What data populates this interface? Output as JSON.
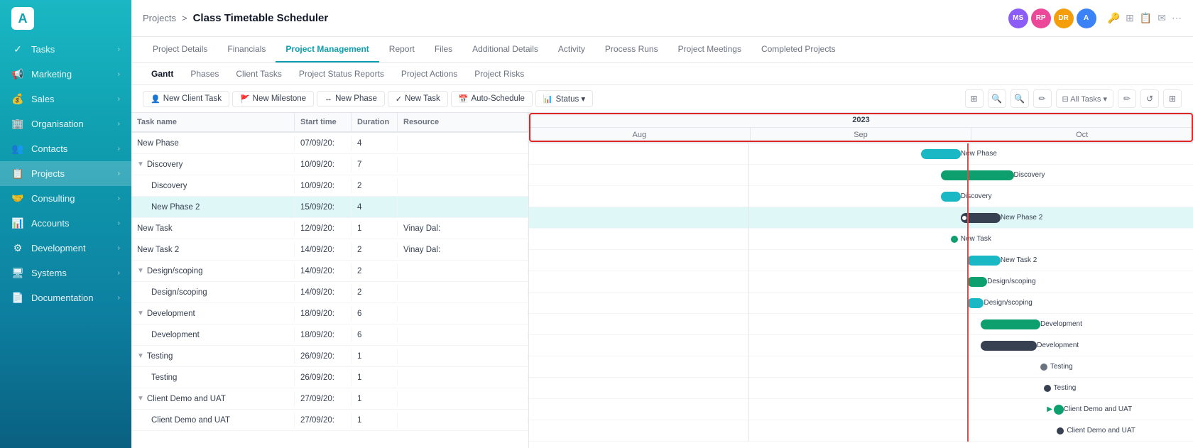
{
  "sidebar": {
    "logo": "A",
    "items": [
      {
        "label": "Tasks",
        "icon": "✓",
        "hasChevron": true
      },
      {
        "label": "Marketing",
        "icon": "📢",
        "hasChevron": true
      },
      {
        "label": "Sales",
        "icon": "💰",
        "hasChevron": true
      },
      {
        "label": "Organisation",
        "icon": "🏢",
        "hasChevron": true
      },
      {
        "label": "Contacts",
        "icon": "👥",
        "hasChevron": true
      },
      {
        "label": "Projects",
        "icon": "📋",
        "hasChevron": true,
        "active": true
      },
      {
        "label": "Consulting",
        "icon": "🤝",
        "hasChevron": true
      },
      {
        "label": "Accounts",
        "icon": "📊",
        "hasChevron": true
      },
      {
        "label": "Development",
        "icon": "⚙",
        "hasChevron": true
      },
      {
        "label": "Systems",
        "icon": "🖥",
        "hasChevron": true
      },
      {
        "label": "Documentation",
        "icon": "📄",
        "hasChevron": true
      }
    ]
  },
  "header": {
    "breadcrumb_parent": "Projects",
    "breadcrumb_sep": ">",
    "title": "Class Timetable Scheduler",
    "avatars": [
      {
        "initials": "MS",
        "color": "#8b5cf6"
      },
      {
        "initials": "RP",
        "color": "#ec4899"
      },
      {
        "initials": "DR",
        "color": "#f59e0b"
      },
      {
        "initials": "A",
        "color": "#3b82f6"
      }
    ]
  },
  "main_tabs": [
    {
      "label": "Project Details",
      "active": false
    },
    {
      "label": "Financials",
      "active": false
    },
    {
      "label": "Project Management",
      "active": true
    },
    {
      "label": "Report",
      "active": false
    },
    {
      "label": "Files",
      "active": false
    },
    {
      "label": "Additional Details",
      "active": false
    },
    {
      "label": "Activity",
      "active": false
    },
    {
      "label": "Process Runs",
      "active": false
    },
    {
      "label": "Project Meetings",
      "active": false
    },
    {
      "label": "Completed Projects",
      "active": false
    }
  ],
  "sub_tabs": [
    {
      "label": "Gantt",
      "active": true
    },
    {
      "label": "Phases",
      "active": false
    },
    {
      "label": "Client Tasks",
      "active": false
    },
    {
      "label": "Project Status Reports",
      "active": false
    },
    {
      "label": "Project Actions",
      "active": false
    },
    {
      "label": "Project Risks",
      "active": false
    }
  ],
  "toolbar": {
    "buttons": [
      {
        "label": "New Client Task",
        "icon": "👤"
      },
      {
        "label": "New Milestone",
        "icon": "🚩"
      },
      {
        "label": "New Phase",
        "icon": "↔"
      },
      {
        "label": "New Task",
        "icon": "✓"
      },
      {
        "label": "Auto-Schedule",
        "icon": "📅"
      },
      {
        "label": "Status ▾",
        "icon": "📊"
      }
    ],
    "right_icons": [
      "⊞",
      "🔍+",
      "🔍-",
      "✏",
      "⊟",
      "All Tasks ▾",
      "✏",
      "↺",
      "⊞"
    ]
  },
  "task_list": {
    "headers": [
      "Task name",
      "Start time",
      "Duration",
      "Resource"
    ],
    "rows": [
      {
        "indent": 0,
        "name": "New Phase",
        "start": "07/09/20:",
        "duration": "4",
        "resource": "",
        "bold": false,
        "collapse": false
      },
      {
        "indent": 0,
        "name": "Discovery",
        "start": "10/09/20:",
        "duration": "7",
        "resource": "",
        "bold": false,
        "collapse": true
      },
      {
        "indent": 1,
        "name": "Discovery",
        "start": "10/09/20:",
        "duration": "2",
        "resource": "",
        "bold": false,
        "collapse": false
      },
      {
        "indent": 1,
        "name": "New Phase 2",
        "start": "15/09/20:",
        "duration": "4",
        "resource": "",
        "bold": false,
        "collapse": false,
        "highlighted": true
      },
      {
        "indent": 0,
        "name": "New Task",
        "start": "12/09/20:",
        "duration": "1",
        "resource": "Vinay Dal:",
        "bold": false,
        "collapse": false
      },
      {
        "indent": 0,
        "name": "New Task 2",
        "start": "14/09/20:",
        "duration": "2",
        "resource": "Vinay Dal:",
        "bold": false,
        "collapse": false
      },
      {
        "indent": 0,
        "name": "Design/scoping",
        "start": "14/09/20:",
        "duration": "2",
        "resource": "",
        "bold": false,
        "collapse": true
      },
      {
        "indent": 1,
        "name": "Design/scoping",
        "start": "14/09/20:",
        "duration": "2",
        "resource": "",
        "bold": false,
        "collapse": false
      },
      {
        "indent": 0,
        "name": "Development",
        "start": "18/09/20:",
        "duration": "6",
        "resource": "",
        "bold": false,
        "collapse": true
      },
      {
        "indent": 1,
        "name": "Development",
        "start": "18/09/20:",
        "duration": "6",
        "resource": "",
        "bold": false,
        "collapse": false
      },
      {
        "indent": 0,
        "name": "Testing",
        "start": "26/09/20:",
        "duration": "1",
        "resource": "",
        "bold": false,
        "collapse": true
      },
      {
        "indent": 1,
        "name": "Testing",
        "start": "26/09/20:",
        "duration": "1",
        "resource": "",
        "bold": false,
        "collapse": false
      },
      {
        "indent": 0,
        "name": "Client Demo and UAT",
        "start": "27/09/20:",
        "duration": "1",
        "resource": "",
        "bold": false,
        "collapse": true
      },
      {
        "indent": 1,
        "name": "Client Demo and UAT",
        "start": "27/09/20:",
        "duration": "1",
        "resource": "",
        "bold": false,
        "collapse": false
      }
    ]
  },
  "gantt": {
    "year": "2023",
    "months": [
      "Aug",
      "Sep",
      "Oct"
    ],
    "bars": [
      {
        "row": 0,
        "left_pct": 59,
        "width_pct": 6,
        "color": "#1ab8c4",
        "label": "New Phase",
        "label_offset": 100
      },
      {
        "row": 1,
        "left_pct": 62,
        "width_pct": 11,
        "color": "#0e9f6e",
        "label": "Discovery",
        "is_dot": false
      },
      {
        "row": 2,
        "left_pct": 62,
        "width_pct": 3,
        "color": "#1ab8c4",
        "label": "Discovery"
      },
      {
        "row": 3,
        "left_pct": 65,
        "width_pct": 6,
        "color": "#374151",
        "label": "New Phase 2",
        "has_circle": true
      },
      {
        "row": 4,
        "left_pct": 63.5,
        "width_pct": 0,
        "color": "#0e9f6e",
        "label": "New Task",
        "is_dot": true,
        "dot_color": "#0e9f6e"
      },
      {
        "row": 5,
        "left_pct": 66,
        "width_pct": 5,
        "color": "#1ab8c4",
        "label": "New Task 2"
      },
      {
        "row": 6,
        "left_pct": 66,
        "width_pct": 3,
        "color": "#0e9f6e",
        "label": "Design/scoping"
      },
      {
        "row": 7,
        "left_pct": 66,
        "width_pct": 2.5,
        "color": "#1ab8c4",
        "label": "Design/scoping"
      },
      {
        "row": 8,
        "left_pct": 68,
        "width_pct": 9,
        "color": "#0e9f6e",
        "label": "Development"
      },
      {
        "row": 9,
        "left_pct": 68,
        "width_pct": 8.5,
        "color": "#374151",
        "label": "Development"
      },
      {
        "row": 10,
        "left_pct": 77,
        "width_pct": 1.5,
        "color": "#9ca3af",
        "label": "Testing",
        "is_dot": true,
        "dot_color": "#6b7280"
      },
      {
        "row": 11,
        "left_pct": 77.5,
        "width_pct": 0,
        "color": "#374151",
        "label": "Testing",
        "is_dot": true,
        "dot_color": "#374151"
      },
      {
        "row": 12,
        "left_pct": 79,
        "width_pct": 1.5,
        "color": "#0e9f6e",
        "label": "Client Demo and UAT",
        "is_dot": false,
        "has_arrow": true
      },
      {
        "row": 13,
        "left_pct": 79.5,
        "width_pct": 0,
        "color": "#374151",
        "label": "Client Demo and UAT",
        "is_dot": true,
        "dot_color": "#374151"
      }
    ]
  }
}
